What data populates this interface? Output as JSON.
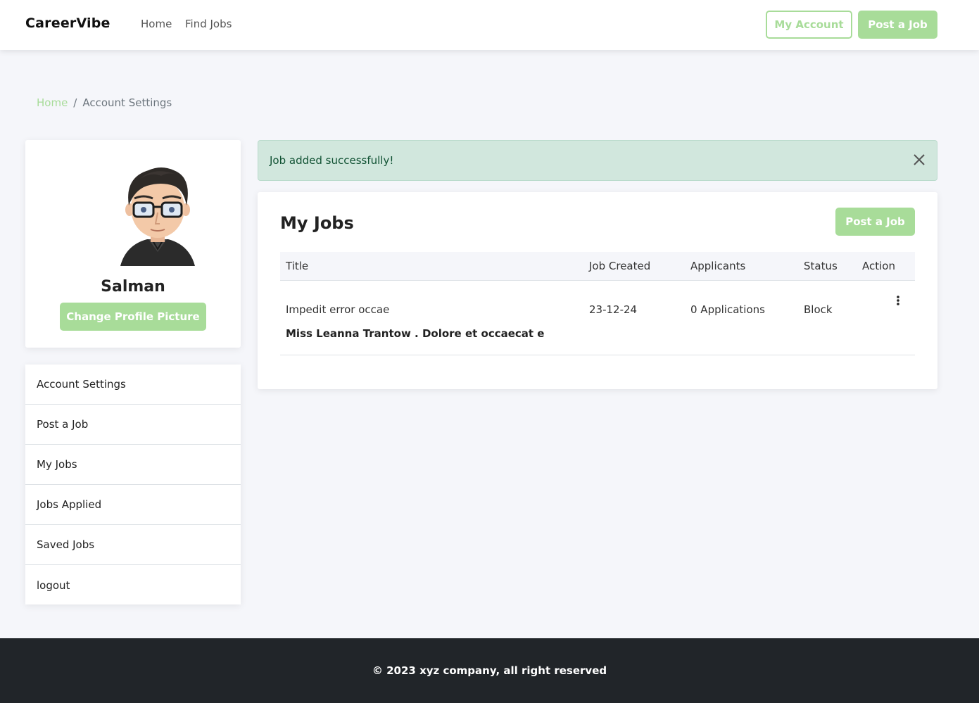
{
  "navbar": {
    "brand": "CareerVibe",
    "links": [
      "Home",
      "Find Jobs"
    ],
    "my_account_label": "My Account",
    "post_job_label": "Post a Job"
  },
  "breadcrumb": {
    "home": "Home",
    "separator": "/",
    "current": "Account Settings"
  },
  "profile": {
    "name": "Salman",
    "change_picture_label": "Change Profile Picture"
  },
  "menu": {
    "items": [
      "Account Settings",
      "Post a Job",
      "My Jobs",
      "Jobs Applied",
      "Saved Jobs",
      "logout"
    ]
  },
  "alert": {
    "message": "Job added successfully!"
  },
  "jobs": {
    "title": "My Jobs",
    "post_job_label": "Post a Job",
    "columns": [
      "Title",
      "Job Created",
      "Applicants",
      "Status",
      "Action"
    ],
    "rows": [
      {
        "title": "Impedit error occae",
        "subtitle": "Miss Leanna Trantow . Dolore et occaecat e",
        "created": "23-12-24",
        "applicants": "0 Applications",
        "status": "Block"
      }
    ]
  },
  "footer": {
    "text": "© 2023 xyz company, all right reserved"
  },
  "colors": {
    "accent": "#a8dc99",
    "alert_bg": "#d1e7dd",
    "alert_text": "#0f5132",
    "footer_bg": "#212529"
  }
}
